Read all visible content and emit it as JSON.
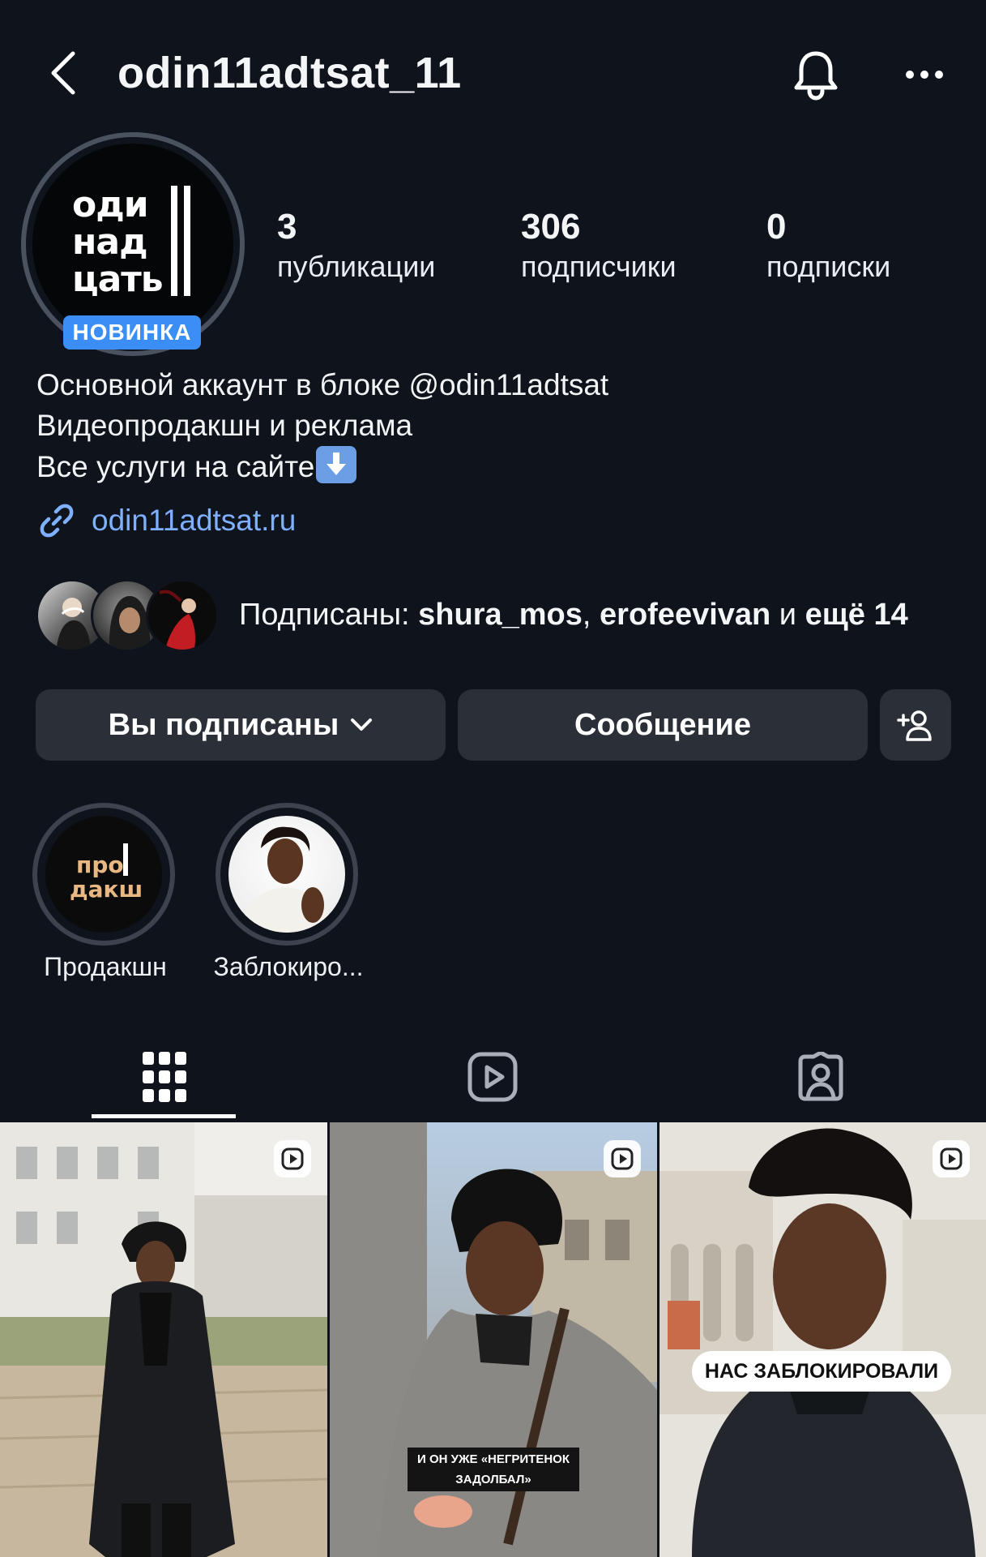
{
  "header": {
    "username": "odin11adtsat_11"
  },
  "profile": {
    "avatar_logo_lines": [
      "оди",
      "над",
      "цать"
    ],
    "new_badge": "НОВИНКА",
    "stats": [
      {
        "count": "3",
        "label": "публикации"
      },
      {
        "count": "306",
        "label": "подписчики"
      },
      {
        "count": "0",
        "label": "подписки"
      }
    ],
    "bio_lines": [
      "Основной аккаунт в блоке @odin11adtsat",
      "Видеопродакшн и реклама",
      "Все услуги на сайте"
    ],
    "link": "odin11adtsat.ru"
  },
  "followed_by": {
    "prefix": "Подписаны: ",
    "user1": "shura_mos",
    "sep": ", ",
    "user2": "erofeevivan",
    "and": " и ",
    "more": "ещё 14"
  },
  "actions": {
    "following": "Вы подписаны",
    "message": "Сообщение"
  },
  "highlights": [
    {
      "label": "Продакшн",
      "logo_text": [
        "про",
        "дакш"
      ]
    },
    {
      "label": "Заблокиро..."
    }
  ],
  "tabs": [
    "grid",
    "reels",
    "tagged"
  ],
  "posts": [
    {
      "caption": ""
    },
    {
      "caption_line1": "И ОН УЖЕ «НЕГРИТЕНОК",
      "caption_line2": "ЗАДОЛБАЛ»"
    },
    {
      "caption": "НАС ЗАБЛОКИРОВАЛИ"
    }
  ],
  "colors": {
    "background": "#0e131c",
    "button": "#2b3038",
    "badge": "#3b8ef6",
    "link": "#7fb0ff"
  }
}
